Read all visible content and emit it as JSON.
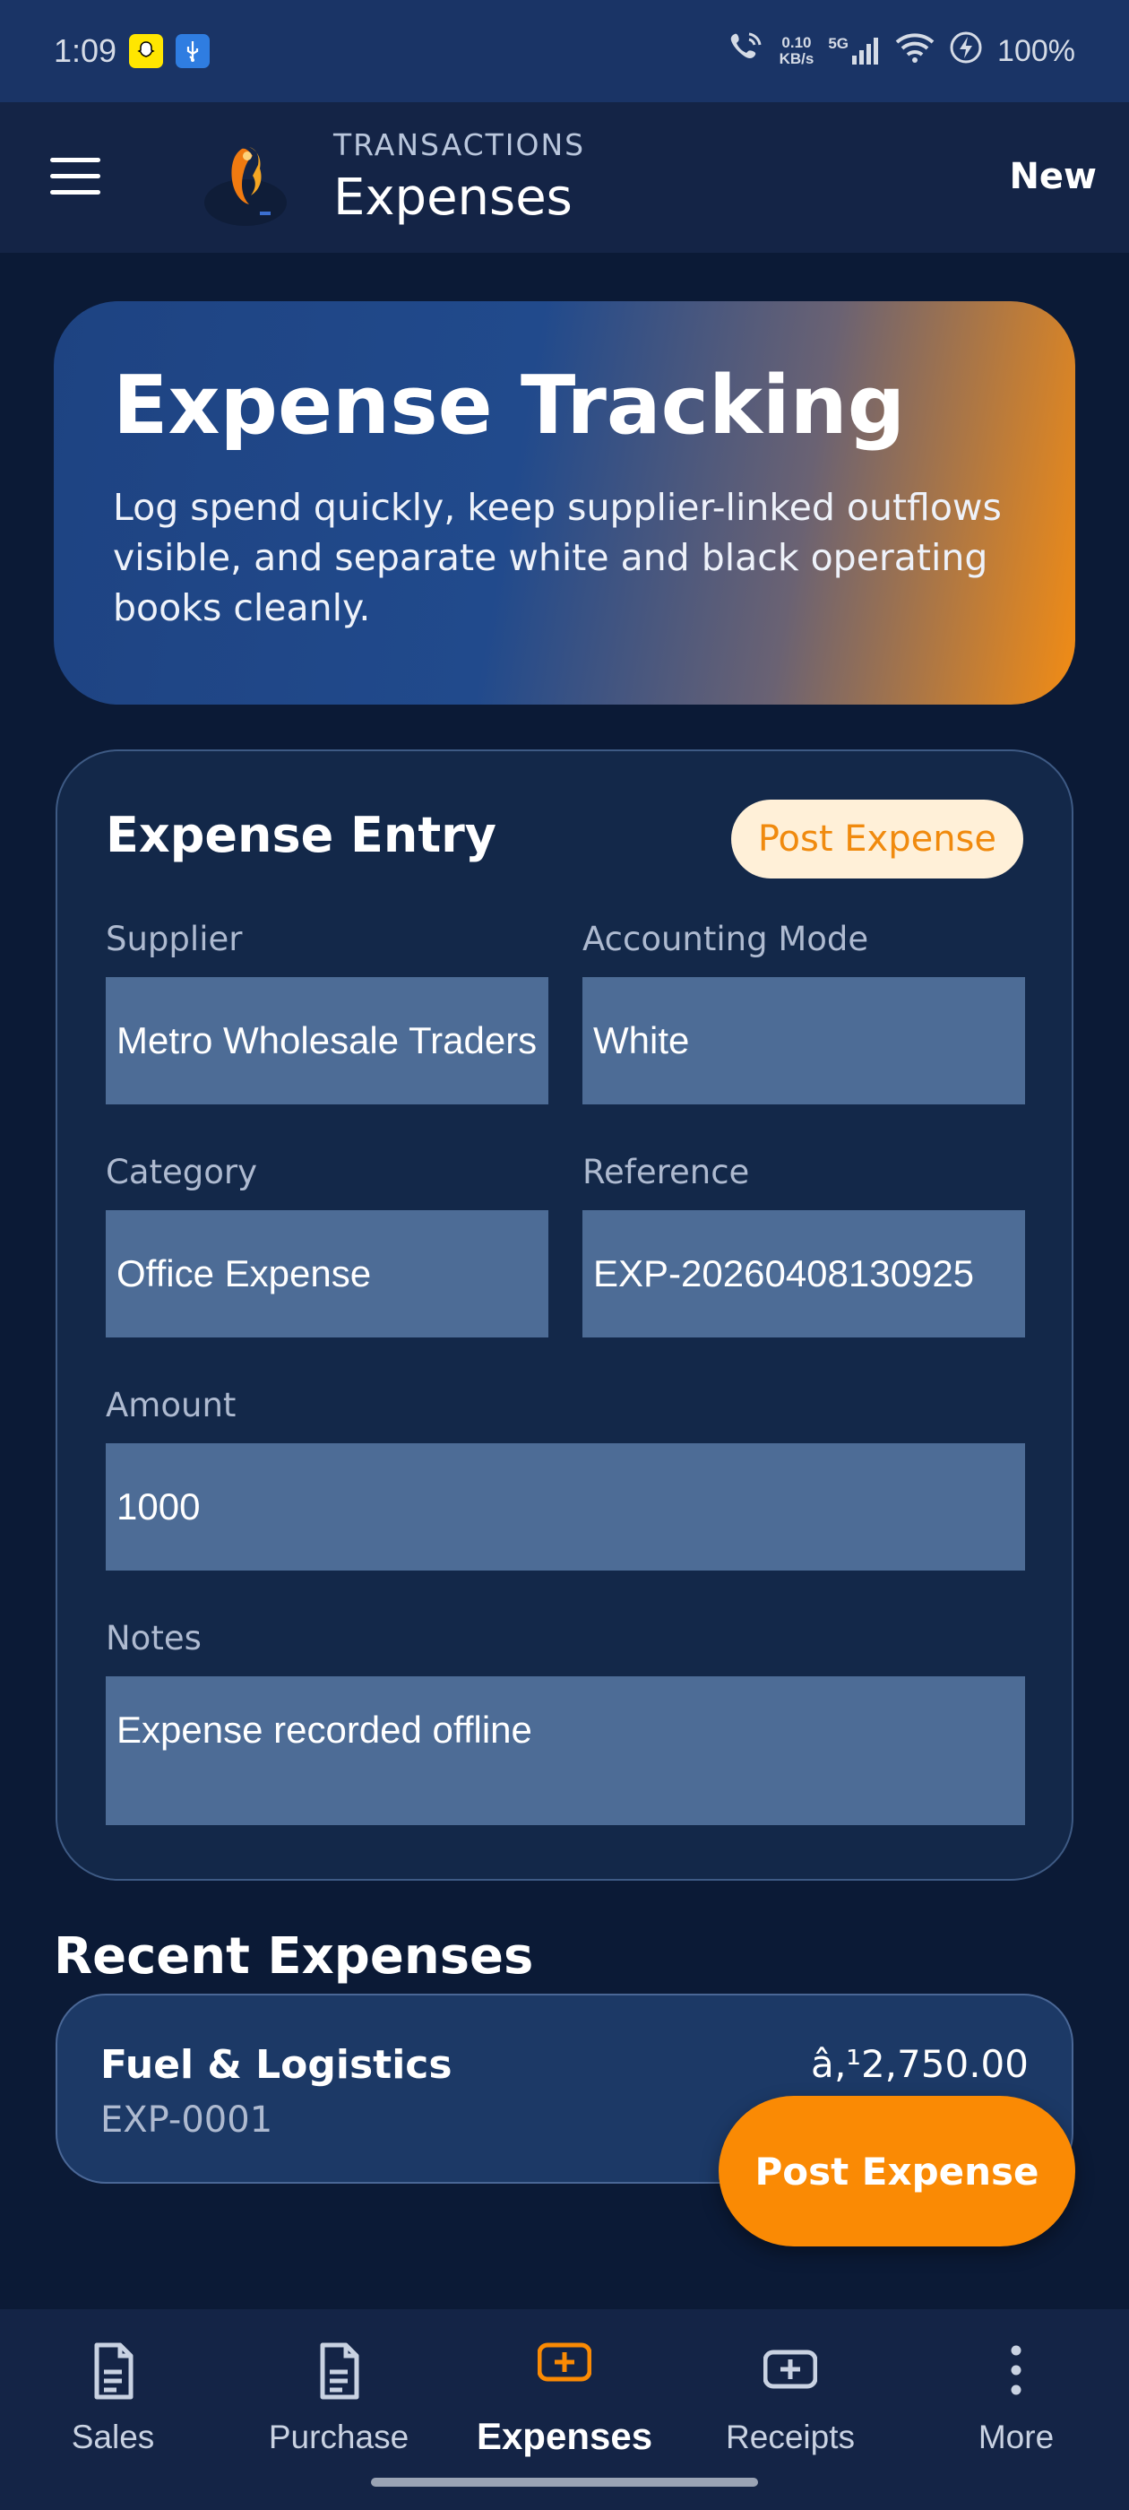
{
  "status_bar": {
    "time": "1:09",
    "net_speed_value": "0.10",
    "net_speed_unit": "KB/s",
    "network": "5G",
    "battery": "100%"
  },
  "app_bar": {
    "kicker": "TRANSACTIONS",
    "title": "Expenses",
    "action": "New"
  },
  "hero": {
    "title": "Expense Tracking",
    "description": "Log spend quickly, keep supplier-linked outflows visible, and separate white and black operating books cleanly."
  },
  "entry": {
    "title": "Expense Entry",
    "post_button": "Post Expense",
    "fields": {
      "supplier": {
        "label": "Supplier",
        "value": "Metro Wholesale Traders"
      },
      "accounting_mode": {
        "label": "Accounting Mode",
        "value": "White"
      },
      "category": {
        "label": "Category",
        "value": "Office Expense"
      },
      "reference": {
        "label": "Reference",
        "value": "EXP-20260408130925"
      },
      "amount": {
        "label": "Amount",
        "value": "1000"
      },
      "notes": {
        "label": "Notes",
        "value": "Expense recorded offline"
      }
    }
  },
  "recent": {
    "title": "Recent Expenses",
    "items": [
      {
        "name": "Fuel & Logistics",
        "ref": "EXP-0001",
        "amount": "â‚¹2,750.00"
      }
    ]
  },
  "fab": {
    "label": "Post Expense"
  },
  "bottom_nav": {
    "items": [
      {
        "label": "Sales",
        "icon": "document-icon"
      },
      {
        "label": "Purchase",
        "icon": "document-icon"
      },
      {
        "label": "Expenses",
        "icon": "add-box-icon",
        "active": true
      },
      {
        "label": "Receipts",
        "icon": "add-box-icon"
      },
      {
        "label": "More",
        "icon": "more-vertical-icon"
      }
    ]
  },
  "colors": {
    "accent": "#fa8a04",
    "background": "#0b1a36",
    "field": "#4d6c96"
  }
}
